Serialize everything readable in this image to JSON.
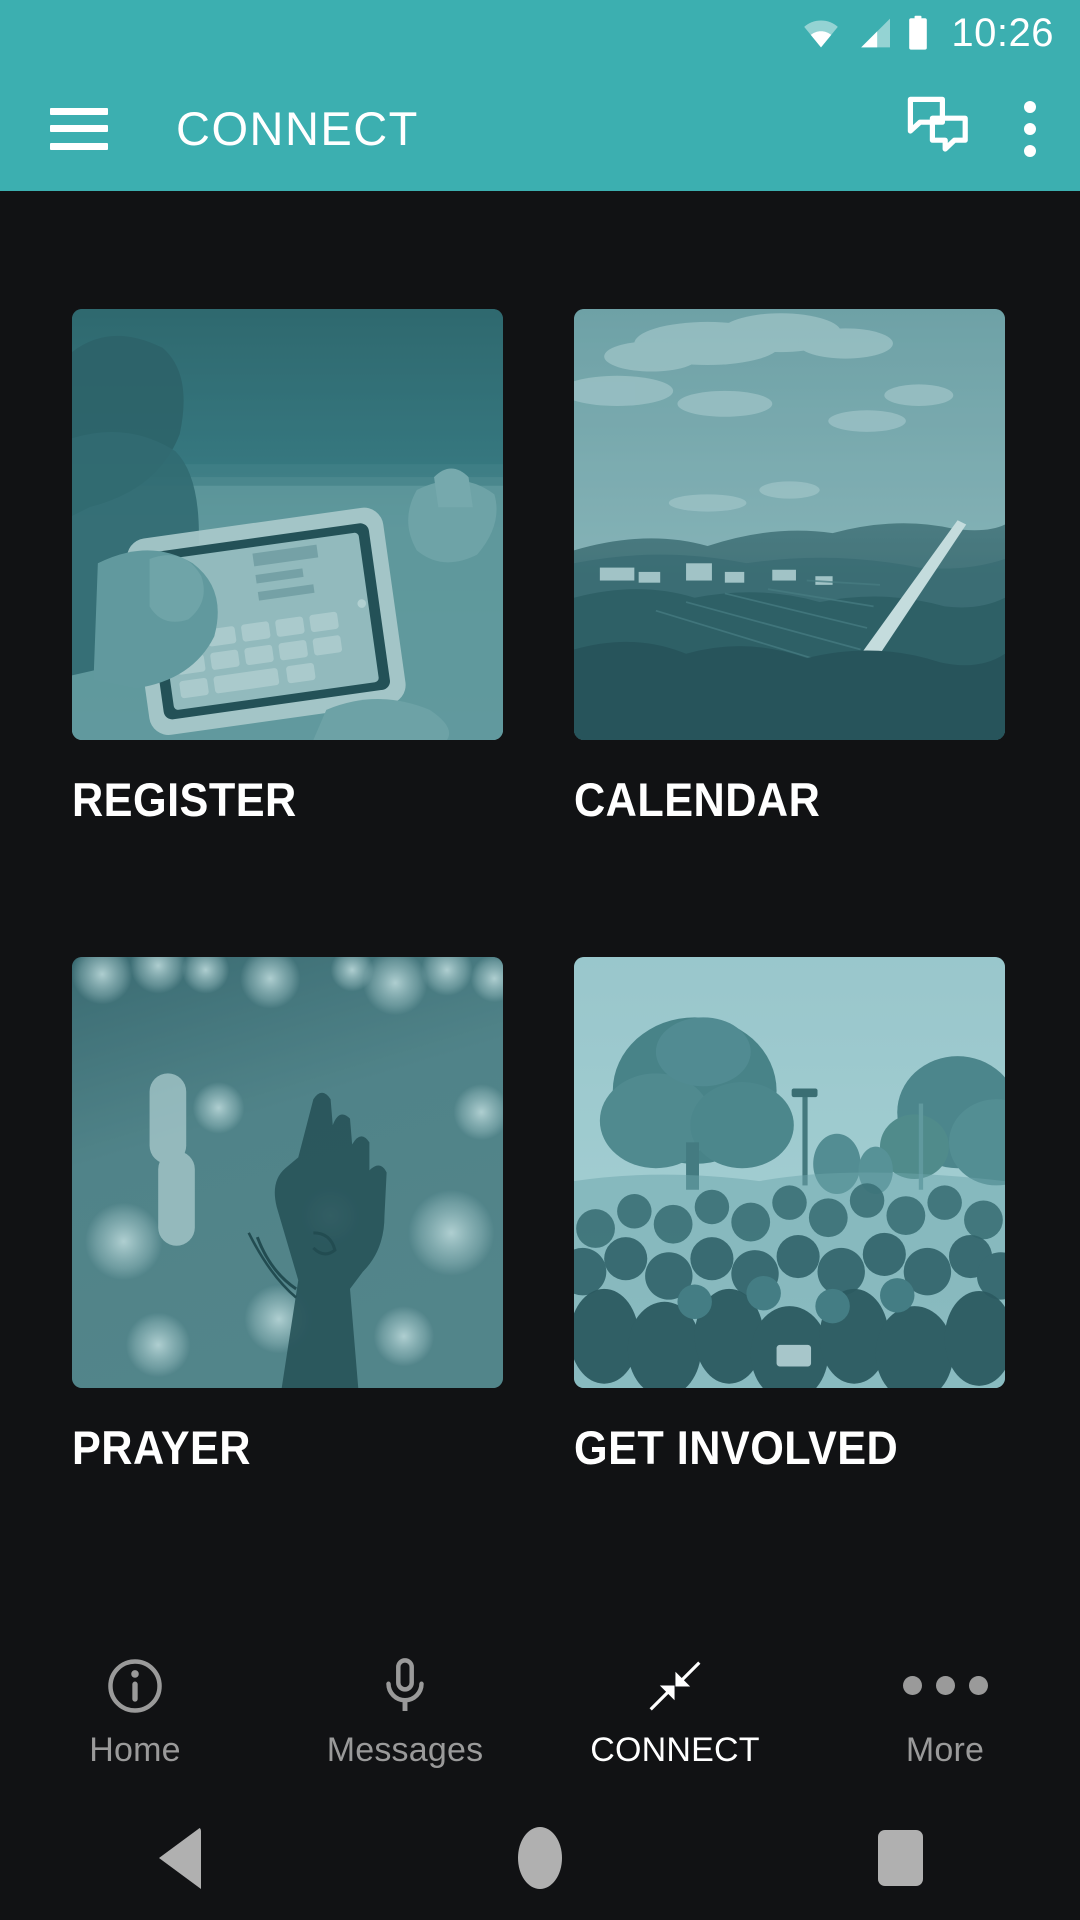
{
  "status_bar": {
    "time": "10:26",
    "icons": [
      "wifi-icon",
      "cellular-signal-icon",
      "battery-icon"
    ],
    "background_color": "#3CAFB0"
  },
  "app_bar": {
    "menu_icon": "hamburger-menu-icon",
    "title": "CONNECT",
    "actions": [
      {
        "icon": "chat-bubbles-icon",
        "name": "messages-action"
      },
      {
        "icon": "overflow-menu-icon",
        "name": "overflow-action"
      }
    ],
    "background_color": "#3CAFB0",
    "text_color": "#FFFFFF"
  },
  "main": {
    "background_color": "#111214",
    "tiles": [
      {
        "label": "REGISTER",
        "image": "child-using-tablet-photo",
        "tint": "#3d7f86"
      },
      {
        "label": "CALENDAR",
        "image": "hillside-landscape-photo",
        "tint": "#7fa9ae"
      },
      {
        "label": "PRAYER",
        "image": "raised-hand-concert-photo",
        "tint": "#4d7a82"
      },
      {
        "label": "GET INVOLVED",
        "image": "outdoor-crowd-gathering-photo",
        "tint": "#9ec8ce"
      }
    ]
  },
  "bottom_nav": {
    "items": [
      {
        "label": "Home",
        "icon": "info-circle-icon",
        "active": false
      },
      {
        "label": "Messages",
        "icon": "microphone-icon",
        "active": false
      },
      {
        "label": "CONNECT",
        "icon": "compress-arrows-icon",
        "active": true
      },
      {
        "label": "More",
        "icon": "three-dots-icon",
        "active": false
      }
    ],
    "active_color": "#FFFFFF",
    "inactive_color": "#9A9A9A"
  },
  "system_nav": {
    "buttons": [
      {
        "name": "back-button",
        "icon": "triangle-back-icon"
      },
      {
        "name": "home-button",
        "icon": "circle-home-icon"
      },
      {
        "name": "recents-button",
        "icon": "square-recents-icon"
      }
    ],
    "icon_color": "#B0B0B0"
  }
}
